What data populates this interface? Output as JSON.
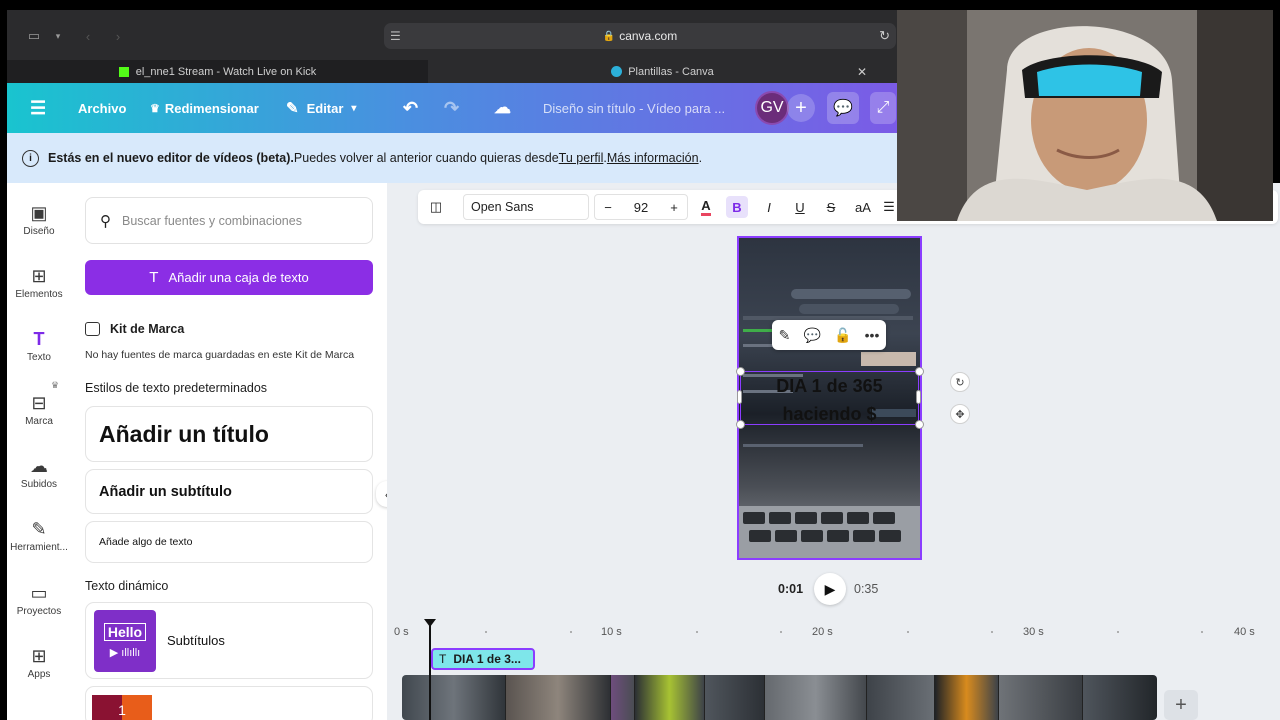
{
  "browser": {
    "url": "canva.com",
    "tabs": [
      {
        "label": "el_nne1 Stream - Watch Live on Kick"
      },
      {
        "label": "Plantillas - Canva"
      }
    ]
  },
  "header": {
    "archivo": "Archivo",
    "redimensionar": "Redimensionar",
    "editar": "Editar",
    "doc_title": "Diseño sin título - Vídeo para ...",
    "avatar": "GV"
  },
  "notice": {
    "text_bold": "Estás en el nuevo editor de vídeos (beta).",
    "text": " Puedes volver al anterior cuando quieras desde ",
    "link1": "Tu perfil",
    "sep": ". ",
    "link2": "Más información",
    "end": "."
  },
  "rail": [
    {
      "label": "Diseño"
    },
    {
      "label": "Elementos"
    },
    {
      "label": "Texto"
    },
    {
      "label": "Marca"
    },
    {
      "label": "Subidos"
    },
    {
      "label": "Herramient..."
    },
    {
      "label": "Proyectos"
    },
    {
      "label": "Apps"
    }
  ],
  "panel": {
    "search_placeholder": "Buscar fuentes y combinaciones",
    "add_text_box": "Añadir una caja de texto",
    "brand_kit_title": "Kit de Marca",
    "brand_kit_empty": "No hay fuentes de marca guardadas en este Kit de Marca",
    "default_styles": "Estilos de texto predeterminados",
    "add_title": "Añadir un título",
    "add_subtitle": "Añadir un subtítulo",
    "add_body": "Añade algo de texto",
    "dynamic_text": "Texto dinámico",
    "subtitles": "Subtítulos",
    "hello_thumb": "Hello",
    "number_thumb": "1"
  },
  "toolbar": {
    "font": "Open Sans",
    "size": "92",
    "bold": "B",
    "italic": "I",
    "underline": "U",
    "strike": "S",
    "case": "aA"
  },
  "canvas": {
    "overlay_line1": "DIA 1 de 365",
    "overlay_line2": "haciendo $"
  },
  "playback": {
    "current": "0:01",
    "total": "0:35"
  },
  "timeline": {
    "labels": [
      "0 s",
      "10 s",
      "20 s",
      "30 s",
      "40 s"
    ],
    "text_clip": "DIA 1 de 3..."
  },
  "colors": {
    "accent": "#8b2ee5",
    "selection": "#8b3dff",
    "text_track": "#7ee6ea"
  }
}
